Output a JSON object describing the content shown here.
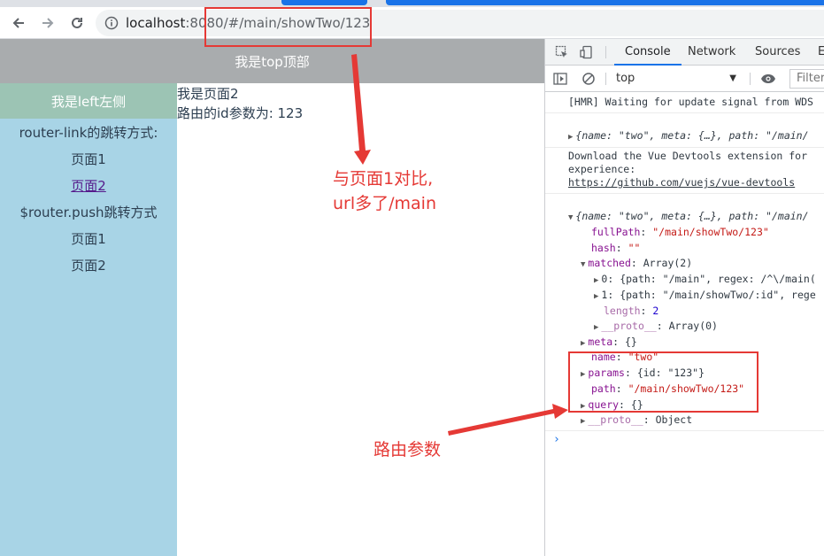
{
  "browser": {
    "url_host": "localhost",
    "url_rest": ":8080/#/main/showTwo/123",
    "back_icon": "arrow-left-icon",
    "forward_icon": "arrow-right-icon",
    "reload_icon": "reload-icon",
    "info_icon": "info-icon"
  },
  "page": {
    "top_title": "我是top顶部",
    "left_title": "我是left左侧",
    "left_items": [
      {
        "label": "router-link的跳转方式:"
      },
      {
        "label": "页面1"
      },
      {
        "label": "页面2"
      },
      {
        "label": "$router.push跳转方式"
      },
      {
        "label": "页面1"
      },
      {
        "label": "页面2"
      }
    ],
    "content_line1": "我是页面2",
    "content_line2": "路由的id参数为: 123"
  },
  "devtools": {
    "tabs": [
      "Console",
      "Network",
      "Sources",
      "E"
    ],
    "context": "top",
    "filter_placeholder": "Filter",
    "console": {
      "hmr": "[HMR] Waiting for update signal from WDS",
      "obj1": "{name: \"two\", meta: {…}, path: \"/main/",
      "devtools_msg1": "Download the Vue Devtools extension for",
      "devtools_msg2": "experience:",
      "devtools_link": "https://github.com/vuejs/vue-devtools",
      "obj2": "{name: \"two\", meta: {…}, path: \"/main/",
      "fullPath_key": "fullPath",
      "fullPath_val": "\"/main/showTwo/123\"",
      "hash_key": "hash",
      "hash_val": "\"\"",
      "matched_key": "matched",
      "matched_val": "Array(2)",
      "m0": "0: {path: \"/main\", regex: /^\\/main(",
      "m1": "1: {path: \"/main/showTwo/:id\", rege",
      "length_key": "length",
      "length_val": "2",
      "proto_key": "__proto__",
      "proto_arr": "Array(0)",
      "meta_key": "meta",
      "meta_val": "{}",
      "name_key": "name",
      "name_val": "\"two\"",
      "params_key": "params",
      "params_val": "{id: \"123\"}",
      "path_key": "path",
      "path_val": "\"/main/showTwo/123\"",
      "query_key": "query",
      "query_val": "{}",
      "proto_obj": "Object"
    }
  },
  "annotations": {
    "note1_line1": "与页面1对比,",
    "note1_line2": "url多了/main",
    "note2": "路由参数",
    "color": "#e53935"
  }
}
